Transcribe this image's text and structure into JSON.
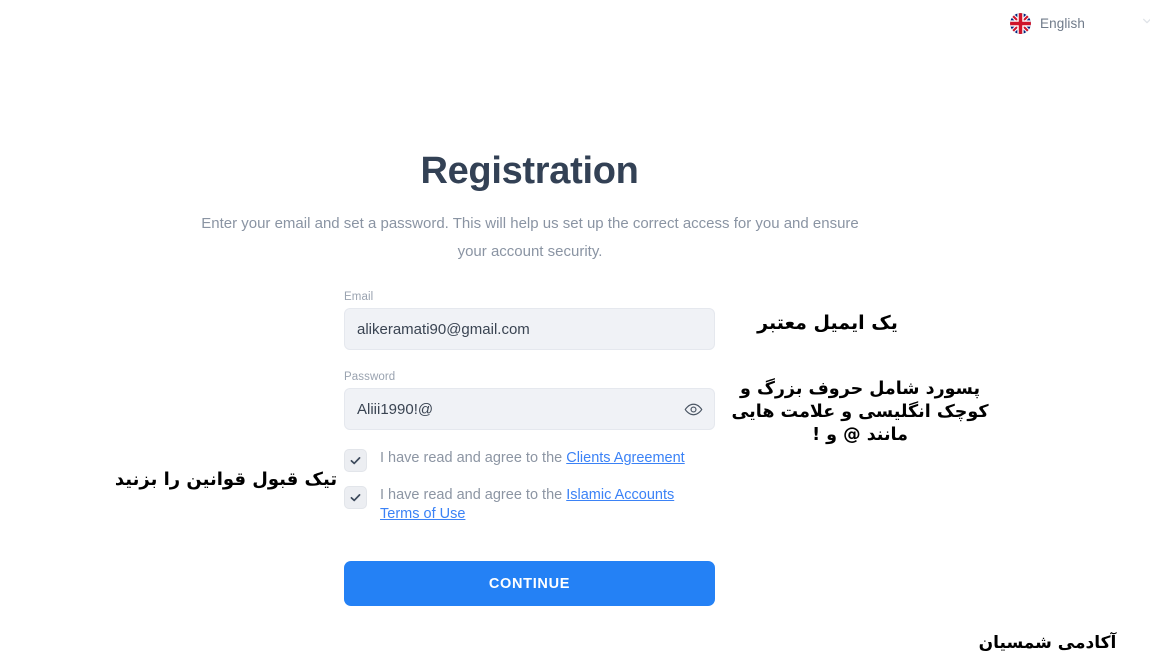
{
  "topbar": {
    "language": {
      "label": "English",
      "flag_icon": "uk-flag-icon",
      "chevron_icon": "chevron-down-icon"
    }
  },
  "main": {
    "title": "Registration",
    "subtitle": "Enter your email and set a password. This will help us set up the correct access for you and ensure your account security."
  },
  "form": {
    "email": {
      "label": "Email",
      "value": "alikeramati90@gmail.com",
      "placeholder": "Email"
    },
    "password": {
      "label": "Password",
      "value": "Aliii1990!@",
      "placeholder": "Password",
      "toggle_icon": "eye-icon"
    },
    "agreements": [
      {
        "checked": true,
        "text": "I have read and agree to the ",
        "link": "Clients Agreement"
      },
      {
        "checked": true,
        "text": "I have read and agree to the ",
        "link": "Islamic Accounts Terms of Use"
      }
    ],
    "submit_label": "CONTINUE"
  },
  "annotations": {
    "email_note": "یک ایمیل معتبر",
    "password_note": "پسورد شامل حروف بزرگ و کوچک انگلیسی و علامت هایی مانند @ و !",
    "terms_note": "تیک قبول قوانین را بزنید",
    "brand": "آکادمی شمسیان"
  },
  "colors": {
    "accent": "#2481f5",
    "link": "#3b82f6",
    "title": "#334155",
    "muted": "#8a94a3",
    "input_bg": "#f0f2f6"
  }
}
